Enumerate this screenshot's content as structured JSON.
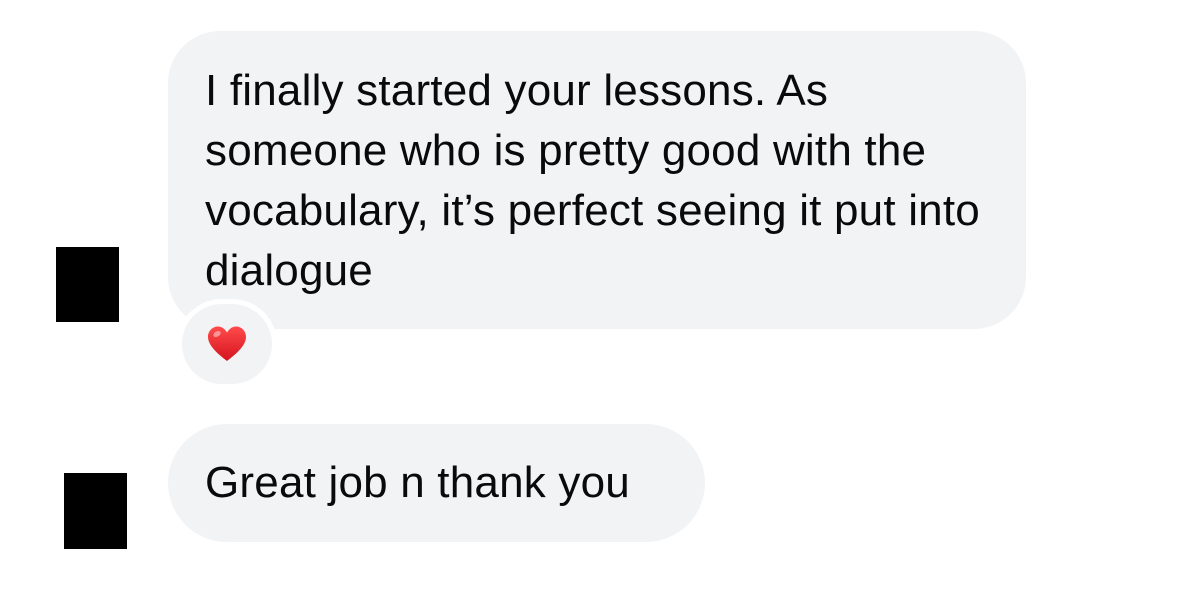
{
  "conversation": {
    "messages": [
      {
        "text": "I finally started your lessons. As someone who is pretty good with the vocabulary, it’s perfect seeing it put into dialogue",
        "reaction": "heart"
      },
      {
        "text": "Great job n thank you"
      }
    ]
  },
  "icons": {
    "avatar": "redacted-avatar",
    "reaction": "red-heart-icon"
  },
  "colors": {
    "bubble_background": "#f2f3f5",
    "text": "#0a0a0a",
    "heart": "#e8202a",
    "avatar": "#000000"
  }
}
